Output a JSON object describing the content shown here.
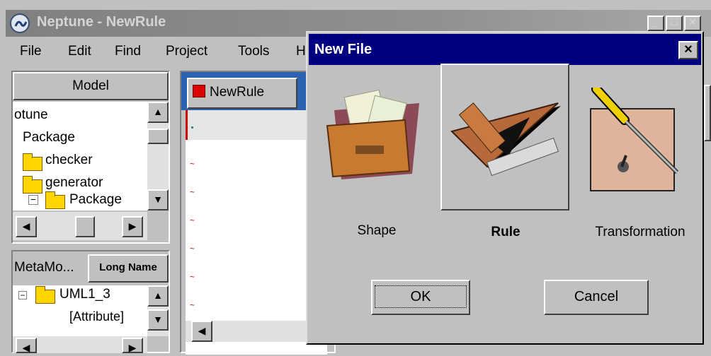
{
  "window": {
    "title": "Neptune - NewRule",
    "minimize_icon": "minimize-icon",
    "maximize_icon": "maximize-icon",
    "close_icon": "close-icon"
  },
  "menubar": {
    "items": [
      "File",
      "Edit",
      "Find",
      "Project",
      "Tools",
      "H"
    ]
  },
  "model_pane": {
    "header": "Model",
    "tree": [
      {
        "label": "otune"
      },
      {
        "label": "Package"
      },
      {
        "label": "checker"
      },
      {
        "label": "generator"
      },
      {
        "label": "Package"
      }
    ]
  },
  "meta_pane": {
    "tab_left": "MetaMo...",
    "tab_right": "Long Name",
    "tree": [
      {
        "label": "UML1_3"
      },
      {
        "label": "[Attribute]"
      }
    ]
  },
  "editor": {
    "tab_label": "NewRule"
  },
  "dialog": {
    "title": "New File",
    "choices": [
      {
        "label": "Shape",
        "icon": "folder-documents-icon"
      },
      {
        "label": "Rule",
        "icon": "triangle-ruler-icon"
      },
      {
        "label": "Transformation",
        "icon": "screwdriver-icon"
      }
    ],
    "ok_label": "OK",
    "cancel_label": "Cancel"
  }
}
